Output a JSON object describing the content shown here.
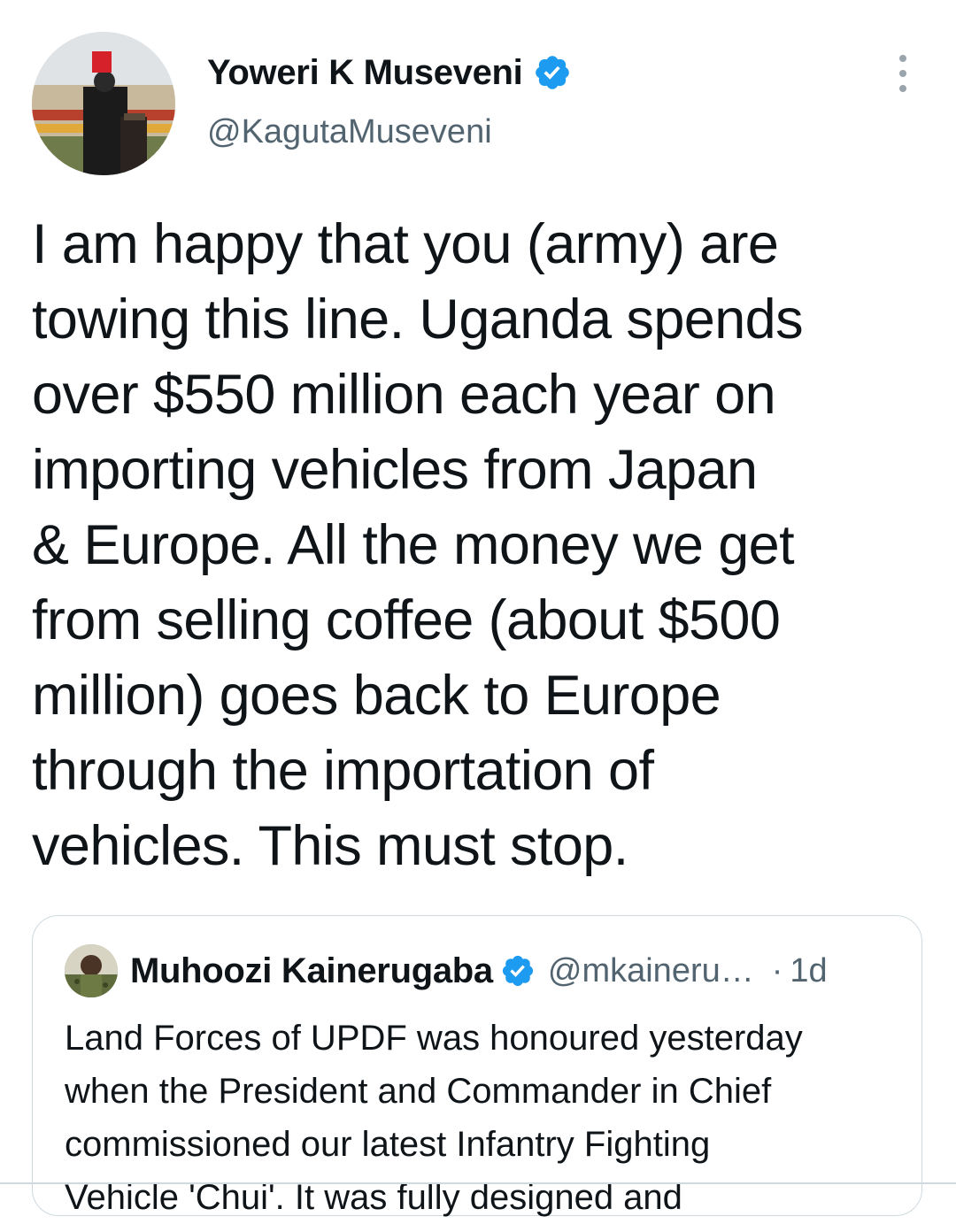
{
  "tweet": {
    "author": {
      "display_name": "Yoweri K Museveni",
      "handle": "@KagutaMuseveni",
      "verified": true,
      "avatar_icon": "profile-photo"
    },
    "more_icon": "more-vertical-icon",
    "text": "I am happy that you (army) are\ntowing this line. Uganda spends\nover $550 million each year on\nimporting vehicles from Japan\n& Europe. All the money we get\nfrom selling coffee (about $500\nmillion) goes back to Europe\nthrough the importation of\nvehicles. This must stop."
  },
  "quoted_tweet": {
    "author": {
      "display_name": "Muhoozi Kainerugaba",
      "handle": "@mkaineru…",
      "verified": true,
      "avatar_icon": "profile-photo"
    },
    "separator": "·",
    "time": "1d",
    "text": "Land Forces of UPDF was honoured yesterday\nwhen the President and Commander in Chief\ncommissioned our latest Infantry Fighting\nVehicle 'Chui'. It was fully designed and"
  },
  "colors": {
    "text_primary": "#0f1419",
    "text_secondary": "#536471",
    "verified_blue": "#1d9bf0",
    "border": "#cfd9de"
  }
}
